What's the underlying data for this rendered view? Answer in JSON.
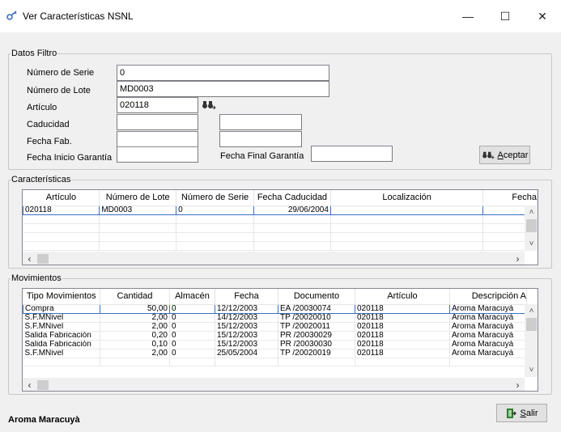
{
  "window": {
    "title": "Ver Características NSNL",
    "min": "—",
    "max": "☐",
    "close": "✕"
  },
  "filtro": {
    "legend": "Datos Filtro",
    "labels": {
      "serie": "Número de Serie",
      "lote": "Número de Lote",
      "articulo": "Artículo",
      "caducidad": "Caducidad",
      "fecha_fab": "Fecha Fab.",
      "fecha_inicio": "Fecha Inicio Garantía",
      "fecha_final": "Fecha Final Garantía"
    },
    "values": {
      "serie": "0",
      "lote": "MD0003",
      "articulo": "020118",
      "caducidad_1": "",
      "caducidad_2": "",
      "fecha_fab_1": "",
      "fecha_fab_2": "",
      "fecha_inicio": "",
      "fecha_final": ""
    },
    "aceptar_label": "Aceptar",
    "aceptar_key": "A",
    "aceptar_rest": "ceptar"
  },
  "caracteristicas": {
    "legend": "Características",
    "columns": [
      "Artículo",
      "Número de Lote",
      "Número de Serie",
      "Fecha Caducidad",
      "Localización",
      "Fecha"
    ],
    "rows": [
      [
        "020118",
        "MD0003",
        "0",
        "29/06/2004",
        "",
        ""
      ]
    ]
  },
  "movimientos": {
    "legend": "Movimientos",
    "columns": [
      "Tipo Movimientos",
      "Cantidad",
      "Almacén",
      "Fecha",
      "Documento",
      "Artículo",
      "Descripción A"
    ],
    "rows": [
      [
        "Compra",
        "50,00",
        "0",
        "12/12/2003",
        "EA /20030074",
        "020118",
        "Aroma Maracuyà"
      ],
      [
        "S.F.MNivel",
        "2,00",
        "0",
        "14/12/2003",
        "TP /20020010",
        "020118",
        "Aroma Maracuyà"
      ],
      [
        "S.F.MNivel",
        "2,00",
        "0",
        "15/12/2003",
        "TP /20020011",
        "020118",
        "Aroma Maracuyà"
      ],
      [
        "Salida Fabricación",
        "0,20",
        "0",
        "15/12/2003",
        "PR /20030029",
        "020118",
        "Aroma Maracuyà"
      ],
      [
        "Salida Fabricación",
        "0,10",
        "0",
        "15/12/2003",
        "PR /20030030",
        "020118",
        "Aroma Maracuyà"
      ],
      [
        "S.F.MNivel",
        "2,00",
        "0",
        "25/05/2004",
        "TP /20020019",
        "020118",
        "Aroma Maracuyà"
      ]
    ]
  },
  "salir_key": "S",
  "salir_rest": "alir",
  "status_text": "Aroma Maracuyà",
  "colors": {
    "selection_border": "#3a6fc1",
    "window_bg": "#f0f0f0"
  },
  "icons": {
    "app": "key-icon",
    "find": "binoculars-icon",
    "exit": "exit-door-icon"
  }
}
